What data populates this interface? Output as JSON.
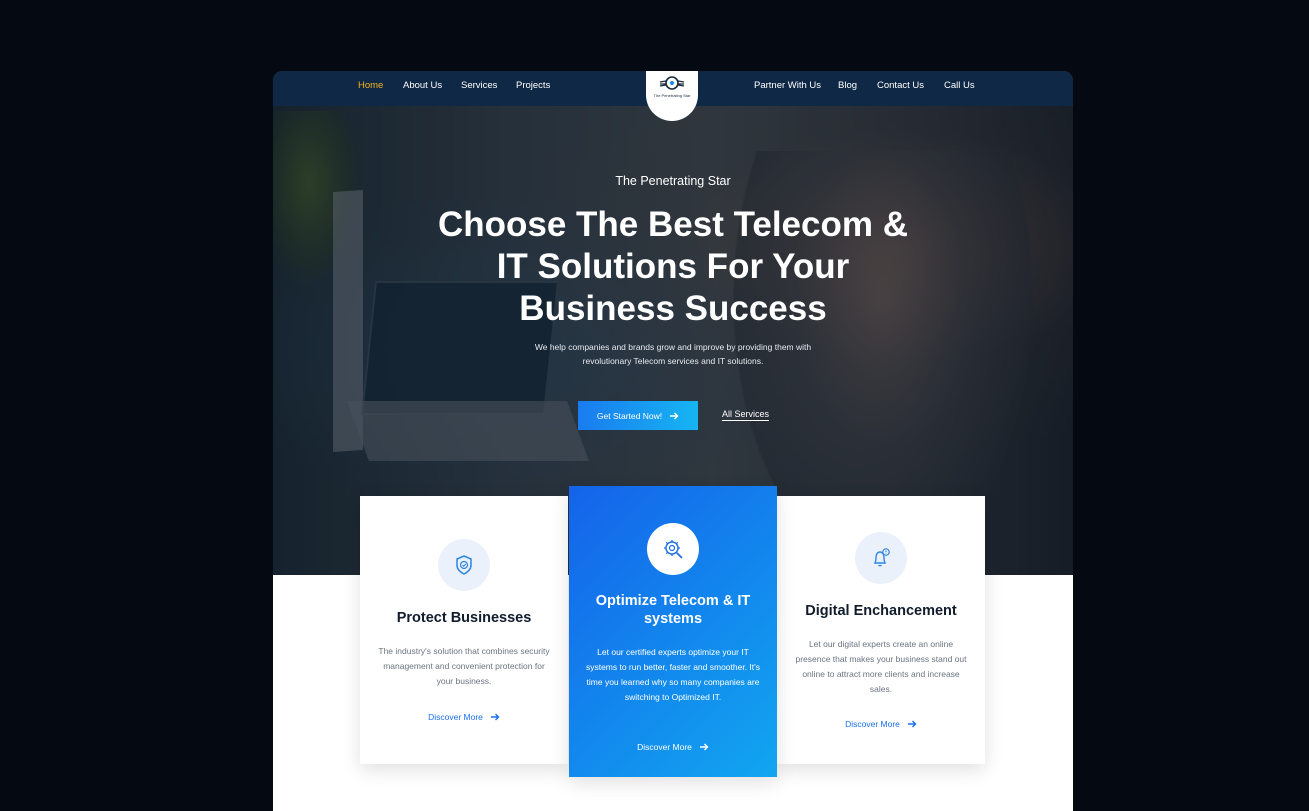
{
  "nav": {
    "left_links": [
      "Home",
      "About Us",
      "Services",
      "Projects"
    ],
    "right_links": [
      "Partner With Us",
      "Blog",
      "Contact Us",
      "Call Us"
    ],
    "active": "Home",
    "logo_text": "The Penetrating Star"
  },
  "hero": {
    "eyebrow": "The Penetrating Star",
    "headline": "Choose The Best Telecom & IT Solutions For Your Business Success",
    "subtext": "We help companies and brands grow and improve by providing them with revolutionary Telecom services and IT solutions.",
    "primary_button": "Get Started Now!",
    "secondary_link": "All Services"
  },
  "cards": [
    {
      "title": "Protect Businesses",
      "text": "The industry's solution that combines security management and convenient protection for your business.",
      "link": "Discover More",
      "icon": "shield-icon"
    },
    {
      "title": "Optimize Telecom & IT systems",
      "text": "Let our certified experts optimize your IT systems to run better, faster and smoother. It's time you learned why so many companies are switching to Optimized IT.",
      "link": "Discover More",
      "icon": "gear-search-icon"
    },
    {
      "title": "Digital Enchancement",
      "text": "Let our digital experts create an online presence that makes your business stand out online to attract more clients and increase sales.",
      "link": "Discover More",
      "icon": "bell-alert-icon"
    }
  ],
  "colors": {
    "accent": "#1b6ff0",
    "nav_bg": "#0f2845",
    "active_nav": "#f5b21e"
  }
}
